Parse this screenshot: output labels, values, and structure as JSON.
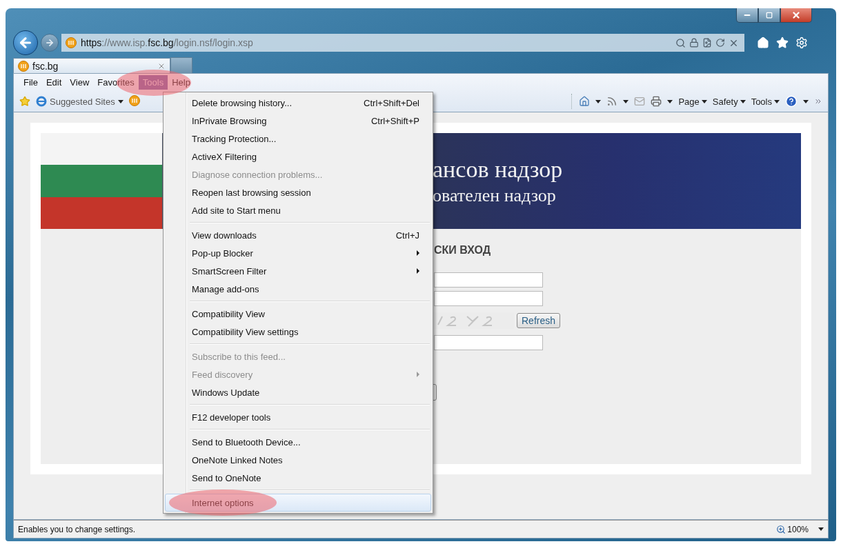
{
  "address_bar": {
    "url_parts": [
      {
        "text": "https",
        "emphasis": true
      },
      {
        "text": "://www.isp.",
        "emphasis": false
      },
      {
        "text": "fsc.bg",
        "emphasis": true
      },
      {
        "text": "/login.nsf/login.xsp",
        "emphasis": false
      }
    ]
  },
  "tabs": [
    {
      "label": "fsc.bg",
      "selected": true
    }
  ],
  "menu_bar": [
    {
      "label": "File",
      "selected": false,
      "circled": false
    },
    {
      "label": "Edit",
      "selected": false,
      "circled": false
    },
    {
      "label": "View",
      "selected": false,
      "circled": false
    },
    {
      "label": "Favorites",
      "selected": false,
      "circled": false
    },
    {
      "label": "Tools",
      "selected": true,
      "circled": true
    },
    {
      "label": "Help",
      "selected": false,
      "circled": false
    }
  ],
  "favorites_bar": {
    "label": "Suggested Sites"
  },
  "command_bar": {
    "buttons": [
      "Page",
      "Safety",
      "Tools"
    ]
  },
  "tools_menu": {
    "groups": [
      [
        {
          "label": "Delete browsing history...",
          "shortcut": "Ctrl+Shift+Del",
          "disabled": false,
          "submenu": false,
          "selected": false,
          "circled": false
        },
        {
          "label": "InPrivate Browsing",
          "shortcut": "Ctrl+Shift+P",
          "disabled": false,
          "submenu": false,
          "selected": false,
          "circled": false
        },
        {
          "label": "Tracking Protection...",
          "disabled": false,
          "submenu": false,
          "selected": false,
          "circled": false
        },
        {
          "label": "ActiveX Filtering",
          "disabled": false,
          "submenu": false,
          "selected": false,
          "circled": false
        },
        {
          "label": "Diagnose connection problems...",
          "disabled": true,
          "submenu": false,
          "selected": false,
          "circled": false
        },
        {
          "label": "Reopen last browsing session",
          "disabled": false,
          "submenu": false,
          "selected": false,
          "circled": false
        },
        {
          "label": "Add site to Start menu",
          "disabled": false,
          "submenu": false,
          "selected": false,
          "circled": false
        }
      ],
      [
        {
          "label": "View downloads",
          "shortcut": "Ctrl+J",
          "disabled": false,
          "submenu": false,
          "selected": false,
          "circled": false
        },
        {
          "label": "Pop-up Blocker",
          "disabled": false,
          "submenu": true,
          "selected": false,
          "circled": false
        },
        {
          "label": "SmartScreen Filter",
          "disabled": false,
          "submenu": true,
          "selected": false,
          "circled": false
        },
        {
          "label": "Manage add-ons",
          "disabled": false,
          "submenu": false,
          "selected": false,
          "circled": false
        }
      ],
      [
        {
          "label": "Compatibility View",
          "disabled": false,
          "submenu": false,
          "selected": false,
          "circled": false
        },
        {
          "label": "Compatibility View settings",
          "disabled": false,
          "submenu": false,
          "selected": false,
          "circled": false
        }
      ],
      [
        {
          "label": "Subscribe to this feed...",
          "disabled": true,
          "submenu": false,
          "selected": false,
          "circled": false
        },
        {
          "label": "Feed discovery",
          "disabled": true,
          "submenu": true,
          "selected": false,
          "circled": false
        },
        {
          "label": "Windows Update",
          "disabled": false,
          "submenu": false,
          "selected": false,
          "circled": false
        }
      ],
      [
        {
          "label": "F12 developer tools",
          "disabled": false,
          "submenu": false,
          "selected": false,
          "circled": false
        }
      ],
      [
        {
          "label": "Send to Bluetooth Device...",
          "disabled": false,
          "submenu": false,
          "selected": false,
          "circled": false
        },
        {
          "label": "OneNote Linked Notes",
          "disabled": false,
          "submenu": false,
          "selected": false,
          "circled": false
        },
        {
          "label": "Send to OneNote",
          "disabled": false,
          "submenu": false,
          "selected": false,
          "circled": false
        }
      ],
      [
        {
          "label": "Internet options",
          "disabled": false,
          "submenu": false,
          "selected": true,
          "circled": true
        }
      ]
    ]
  },
  "page": {
    "banner": {
      "title": "ансов надзор",
      "subtitle": "ователен надзор"
    },
    "login_heading": "СКИ ВХОД",
    "refresh_button": "Refresh"
  },
  "status_bar": {
    "text": "Enables you to change settings.",
    "zoom": "100%"
  }
}
